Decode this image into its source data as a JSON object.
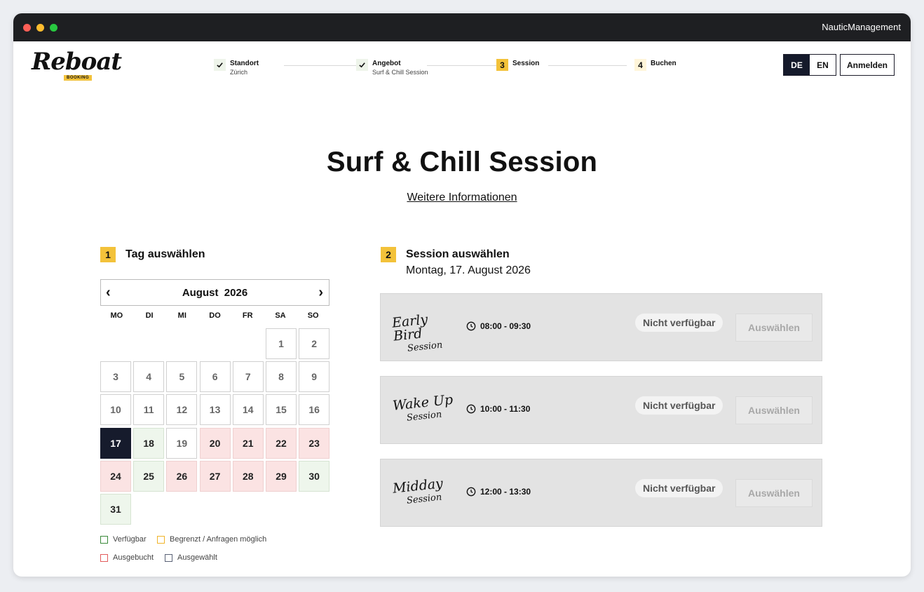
{
  "window": {
    "title": "NauticManagement"
  },
  "brand": {
    "logo_text": "Reboat",
    "logo_badge": "BOOKING"
  },
  "stepper": [
    {
      "num": "",
      "title": "Standort",
      "subtitle": "Zürich",
      "state": "done"
    },
    {
      "num": "",
      "title": "Angebot",
      "subtitle": "Surf & Chill Session",
      "state": "done"
    },
    {
      "num": "3",
      "title": "Session",
      "subtitle": "",
      "state": "active"
    },
    {
      "num": "4",
      "title": "Buchen",
      "subtitle": "",
      "state": "todo"
    }
  ],
  "header": {
    "lang_de": "DE",
    "lang_en": "EN",
    "login_label": "Anmelden",
    "active_lang": "DE"
  },
  "main": {
    "title": "Surf & Chill Session",
    "more_info": "Weitere Informationen"
  },
  "day_section": {
    "num": "1",
    "title": "Tag auswählen"
  },
  "session_section": {
    "num": "2",
    "title": "Session auswählen",
    "date": "Montag, 17. August 2026"
  },
  "calendar": {
    "month_label": "August  2026",
    "weekdays": [
      "MO",
      "DI",
      "MI",
      "DO",
      "FR",
      "SA",
      "SO"
    ],
    "first_col": 5,
    "days": [
      {
        "d": "1",
        "s": "past"
      },
      {
        "d": "2",
        "s": "past"
      },
      {
        "d": "3",
        "s": "past"
      },
      {
        "d": "4",
        "s": "past"
      },
      {
        "d": "5",
        "s": "past"
      },
      {
        "d": "6",
        "s": "past"
      },
      {
        "d": "7",
        "s": "past"
      },
      {
        "d": "8",
        "s": "past"
      },
      {
        "d": "9",
        "s": "past"
      },
      {
        "d": "10",
        "s": "past"
      },
      {
        "d": "11",
        "s": "past"
      },
      {
        "d": "12",
        "s": "past"
      },
      {
        "d": "13",
        "s": "past"
      },
      {
        "d": "14",
        "s": "past"
      },
      {
        "d": "15",
        "s": "past"
      },
      {
        "d": "16",
        "s": "past"
      },
      {
        "d": "17",
        "s": "sel"
      },
      {
        "d": "18",
        "s": "av"
      },
      {
        "d": "19",
        "s": "past"
      },
      {
        "d": "20",
        "s": "bk"
      },
      {
        "d": "21",
        "s": "bk"
      },
      {
        "d": "22",
        "s": "bk"
      },
      {
        "d": "23",
        "s": "bk"
      },
      {
        "d": "24",
        "s": "bk"
      },
      {
        "d": "25",
        "s": "av"
      },
      {
        "d": "26",
        "s": "bk"
      },
      {
        "d": "27",
        "s": "bk"
      },
      {
        "d": "28",
        "s": "bk"
      },
      {
        "d": "29",
        "s": "bk"
      },
      {
        "d": "30",
        "s": "av"
      },
      {
        "d": "31",
        "s": "av"
      }
    ]
  },
  "legend": [
    {
      "label": "Verfügbar",
      "color": "#3a8a3a"
    },
    {
      "label": "Begrenzt / Anfragen möglich",
      "color": "#f0b429"
    },
    {
      "label": "Ausgebucht",
      "color": "#e25c5c"
    },
    {
      "label": "Ausgewählt",
      "color": "#5a6276"
    }
  ],
  "sessions": [
    {
      "name1": "Early Bird",
      "name2": "Session",
      "time": "08:00 - 09:30",
      "status": "Nicht verfügbar",
      "select": "Auswählen"
    },
    {
      "name1": "Wake Up",
      "name2": "Session",
      "time": "10:00 - 11:30",
      "status": "Nicht verfügbar",
      "select": "Auswählen"
    },
    {
      "name1": "Midday",
      "name2": "Session",
      "time": "12:00 - 13:30",
      "status": "Nicht verfügbar",
      "select": "Auswählen"
    }
  ]
}
